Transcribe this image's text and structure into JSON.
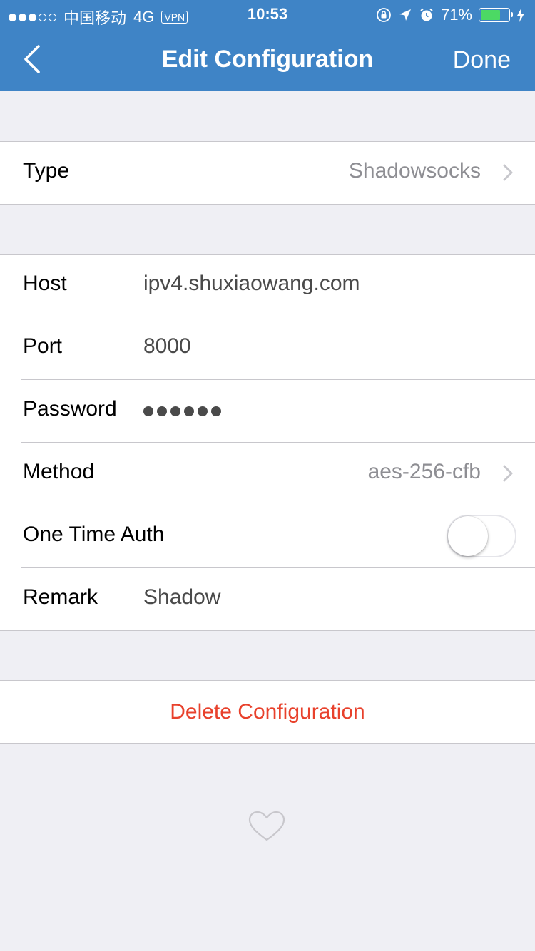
{
  "status": {
    "carrier": "中国移动",
    "network": "4G",
    "vpn": "VPN",
    "time": "10:53",
    "battery": "71%",
    "battery_level": 0.71,
    "battery_color": "#4cd964"
  },
  "nav": {
    "title": "Edit Configuration",
    "done": "Done",
    "back_icon": "chevron-left-icon",
    "bar_color": "#3f84c6"
  },
  "type": {
    "label": "Type",
    "value": "Shadowsocks"
  },
  "config": {
    "host": {
      "label": "Host",
      "value": "ipv4.shuxiaowang.com"
    },
    "port": {
      "label": "Port",
      "value": "8000"
    },
    "password": {
      "label": "Password",
      "masked_length": 6
    },
    "method": {
      "label": "Method",
      "value": "aes-256-cfb"
    },
    "ota": {
      "label": "One Time Auth",
      "enabled": false
    },
    "remark": {
      "label": "Remark",
      "value": "Shadow"
    }
  },
  "delete": {
    "label": "Delete Configuration",
    "color": "#e8412c"
  },
  "footer_icon": "heart-icon"
}
